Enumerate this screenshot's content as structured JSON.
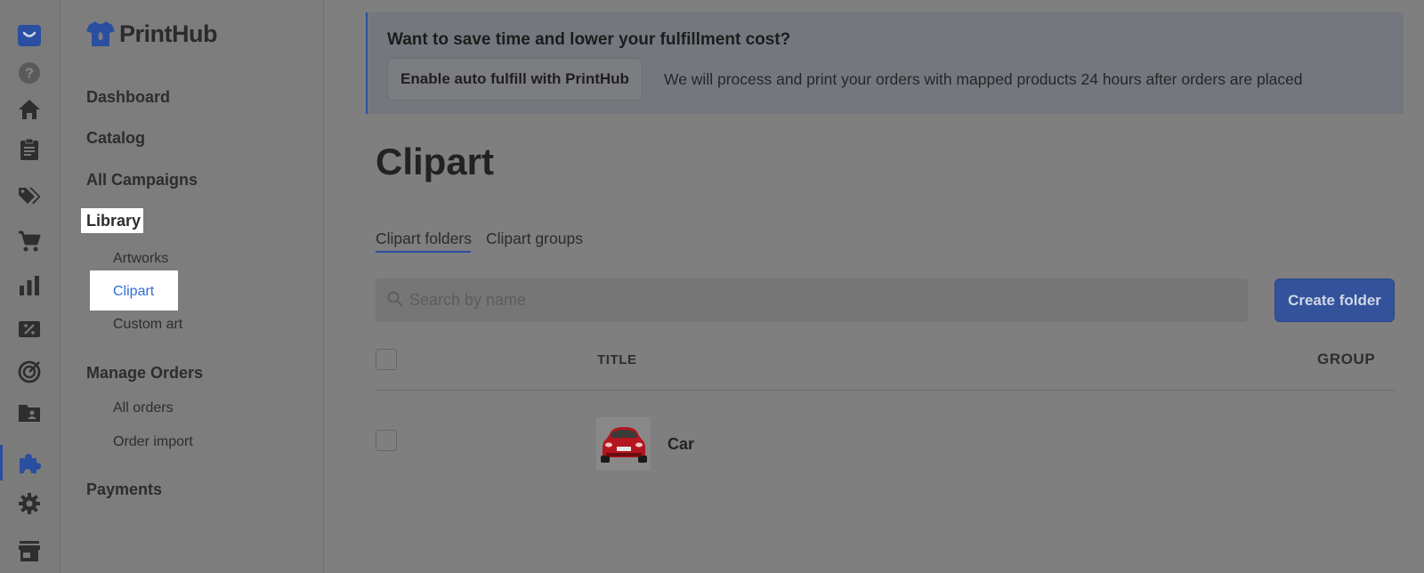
{
  "brand": {
    "name": "PrintHub",
    "accent": "#2a4fa0"
  },
  "rail": {
    "icons": [
      "app-logo-icon",
      "help-icon",
      "home-icon",
      "orders-clipboard-icon",
      "tags-icon",
      "cart-icon",
      "analytics-icon",
      "discount-icon",
      "marketing-target-icon",
      "content-folder-icon",
      "apps-puzzle-icon",
      "settings-gear-icon",
      "store-icon"
    ],
    "active": "apps-puzzle-icon"
  },
  "sidebar": {
    "dashboard": "Dashboard",
    "catalog": "Catalog",
    "all_campaigns": "All Campaigns",
    "library": "Library",
    "artworks": "Artworks",
    "clipart": "Clipart",
    "custom_art": "Custom art",
    "manage_orders": "Manage Orders",
    "all_orders": "All orders",
    "order_import": "Order import",
    "payments": "Payments"
  },
  "banner": {
    "title": "Want to save time and lower your fulfillment cost?",
    "button": "Enable auto fulfill with PrintHub",
    "description": "We will process and print your orders with mapped products 24 hours after orders are placed"
  },
  "page": {
    "title": "Clipart",
    "tabs": [
      "Clipart folders",
      "Clipart groups"
    ],
    "active_tab": "Clipart folders"
  },
  "search": {
    "placeholder": "Search by name",
    "value": ""
  },
  "toolbar": {
    "create_folder": "Create folder"
  },
  "table": {
    "columns": [
      "TITLE",
      "GROUP"
    ],
    "rows": [
      {
        "title": "Car",
        "group": "",
        "thumbnail": "red-car-image"
      }
    ]
  }
}
